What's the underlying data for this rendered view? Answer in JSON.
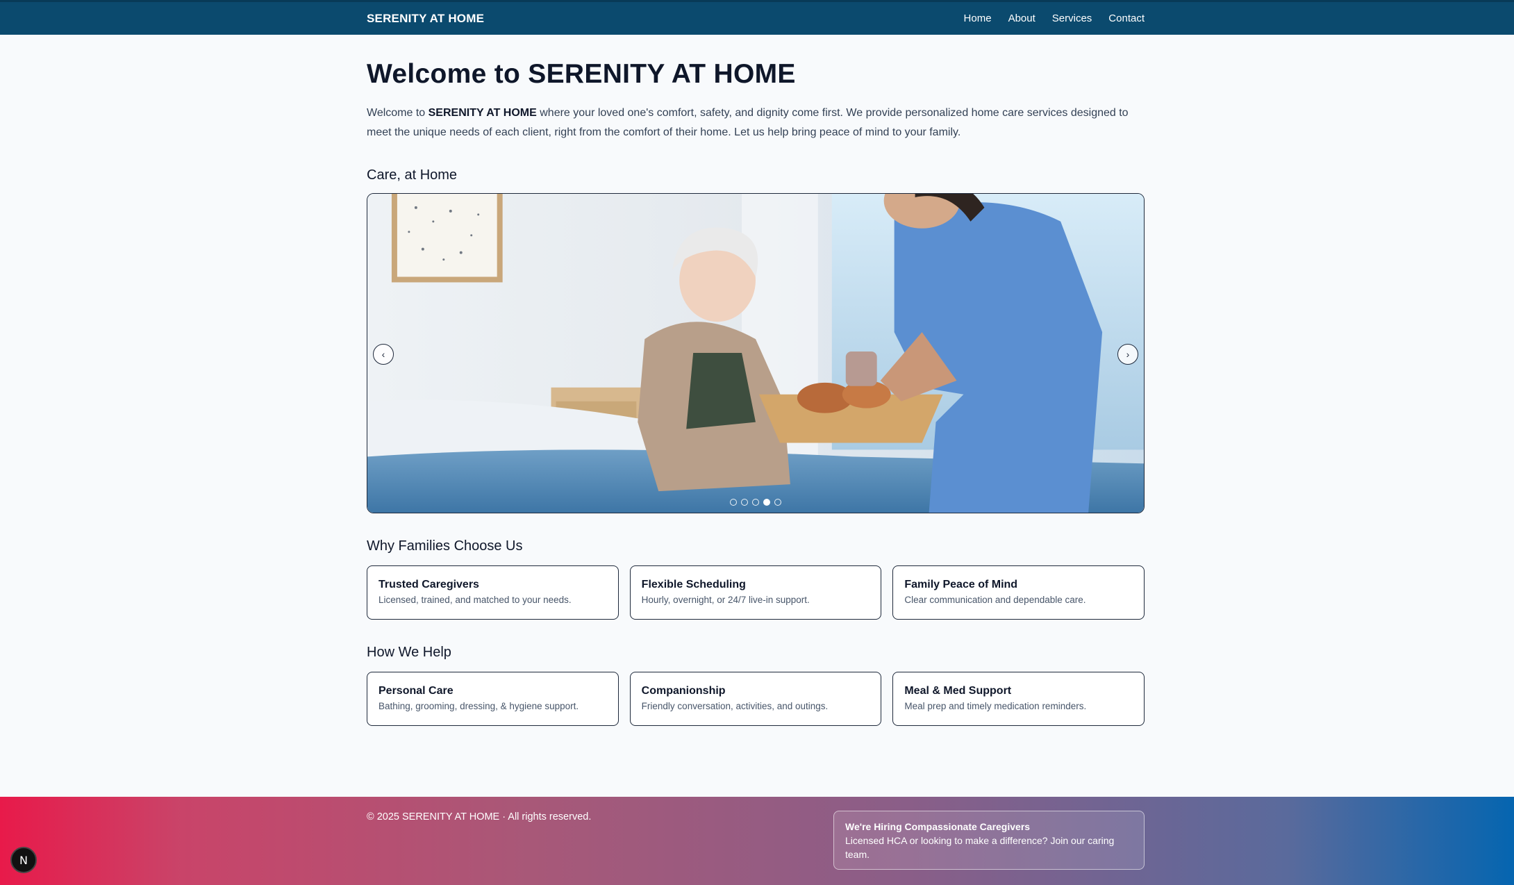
{
  "header": {
    "brand": "SERENITY AT HOME",
    "nav": [
      "Home",
      "About",
      "Services",
      "Contact"
    ]
  },
  "hero": {
    "title": "Welcome to SERENITY AT HOME",
    "intro_prefix": "Welcome to ",
    "intro_brand": "SERENITY AT HOME",
    "intro_suffix": " where your loved one's comfort, safety, and dignity come first. We provide personalized home care services designed to meet the unique needs of each client, right from the comfort of their home. Let us help bring peace of mind to your family."
  },
  "carousel": {
    "heading": "Care, at Home",
    "prev_label": "‹",
    "next_label": "›",
    "slide_count": 5,
    "active_index": 3
  },
  "why": {
    "heading": "Why Families Choose Us",
    "cards": [
      {
        "title": "Trusted Caregivers",
        "desc": "Licensed, trained, and matched to your needs."
      },
      {
        "title": "Flexible Scheduling",
        "desc": "Hourly, overnight, or 24/7 live-in support."
      },
      {
        "title": "Family Peace of Mind",
        "desc": "Clear communication and dependable care."
      }
    ]
  },
  "how": {
    "heading": "How We Help",
    "cards": [
      {
        "title": "Personal Care",
        "desc": "Bathing, grooming, dressing, & hygiene support."
      },
      {
        "title": "Companionship",
        "desc": "Friendly conversation, activities, and outings."
      },
      {
        "title": "Meal & Med Support",
        "desc": "Meal prep and timely medication reminders."
      }
    ]
  },
  "footer": {
    "copyright": "© 2025 SERENITY AT HOME · All rights reserved.",
    "hiring_title": "We're Hiring Compassionate Caregivers",
    "hiring_text": "Licensed HCA or looking to make a difference? Join our caring team."
  },
  "badge": {
    "label": "N"
  },
  "colors": {
    "nav_bg": "#0b4a6e",
    "footer_start": "#e81a4a",
    "footer_end": "#0565b0"
  }
}
